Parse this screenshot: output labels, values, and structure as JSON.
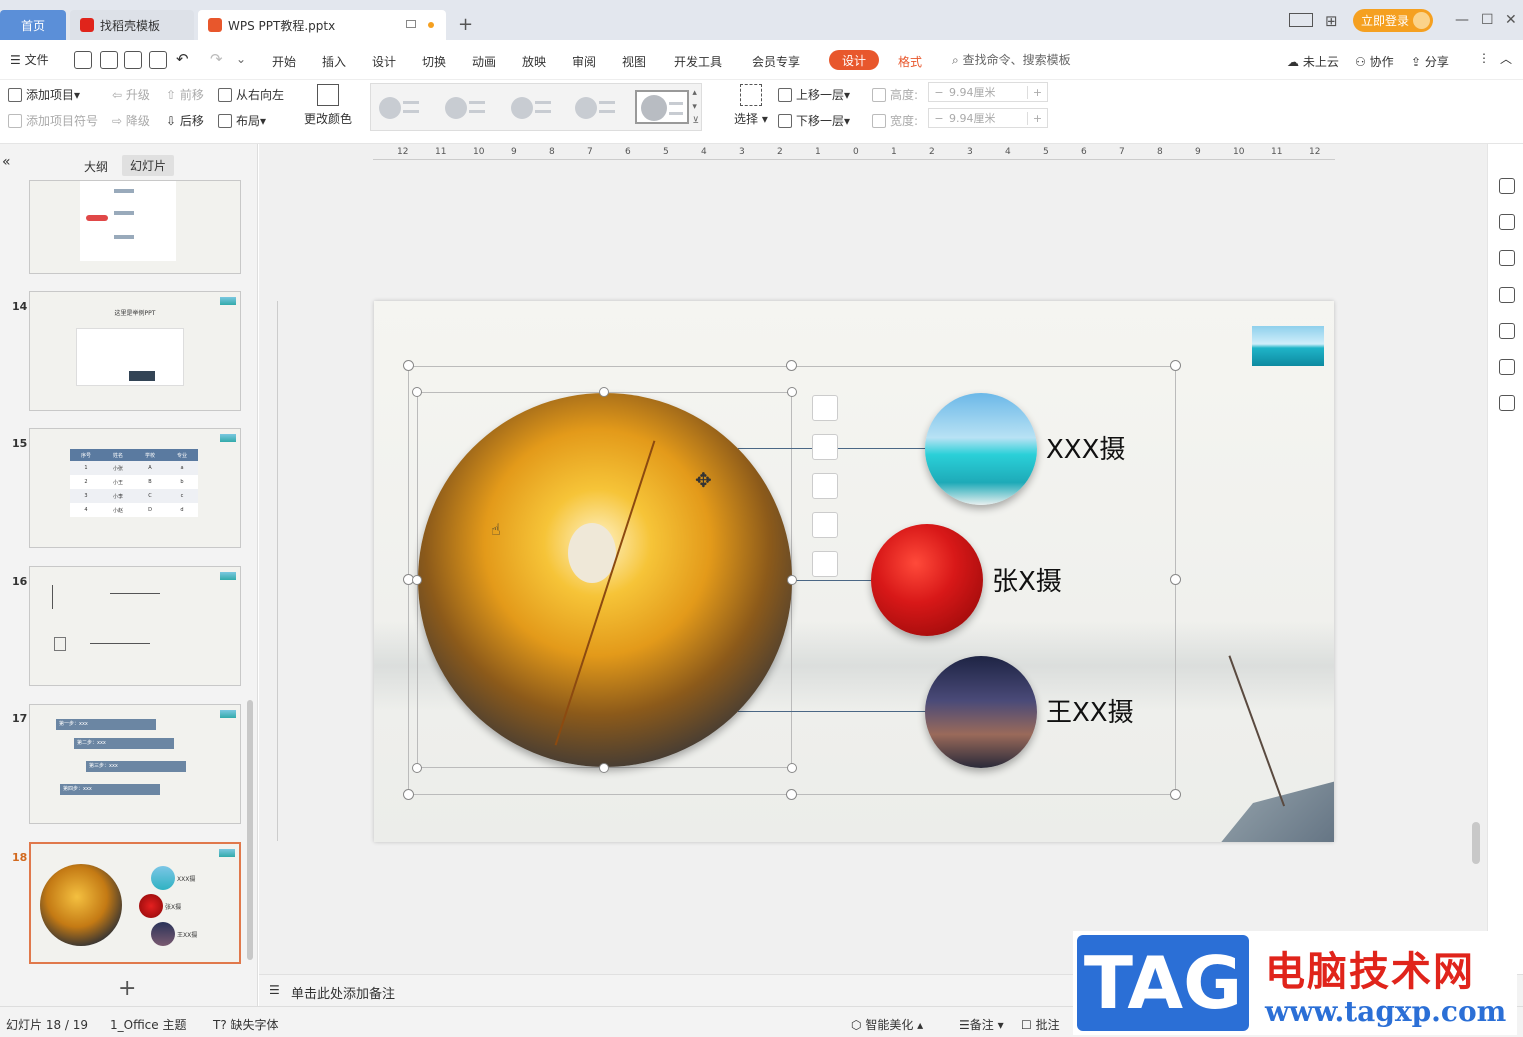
{
  "tabs": {
    "home": "首页",
    "templates": "找稻壳模板",
    "file": "WPS PPT教程.pptx"
  },
  "title_right": {
    "login": "立即登录"
  },
  "menu": {
    "file": "文件",
    "items": [
      "开始",
      "插入",
      "设计",
      "切换",
      "动画",
      "放映",
      "审阅",
      "视图",
      "开发工具",
      "会员专享"
    ],
    "active": "设计",
    "format": "格式",
    "search": "查找命令、搜索模板",
    "cloud": "未上云",
    "collab": "协作",
    "share": "分享"
  },
  "ribbon": {
    "add_item": "添加项目",
    "add_bullet": "添加项目符号",
    "promote": "升级",
    "demote": "降级",
    "move_up": "前移",
    "move_down": "后移",
    "rtl": "从右向左",
    "layout": "布局",
    "change_color": "更改颜色",
    "select": "选择",
    "bring_forward": "上移一层",
    "send_backward": "下移一层",
    "height_label": "高度:",
    "width_label": "宽度:",
    "height_value": "9.94厘米",
    "width_value": "9.94厘米"
  },
  "pane": {
    "outline": "大纲",
    "slides": "幻灯片"
  },
  "thumbnails": [
    {
      "num": "14",
      "title": "这里是举例PPT"
    },
    {
      "num": "15"
    },
    {
      "num": "16"
    },
    {
      "num": "17",
      "steps": [
        "第一步：xxx",
        "第二步：xxx",
        "第三步：xxx",
        "第四步：xxx"
      ]
    },
    {
      "num": "18",
      "captions": [
        "XXX摄",
        "张X摄",
        "王XX摄"
      ]
    }
  ],
  "table15": {
    "headers": [
      "序号",
      "姓名",
      "学校",
      "专业"
    ],
    "rows": [
      [
        "1",
        "小张",
        "A",
        "a"
      ],
      [
        "2",
        "小王",
        "B",
        "b"
      ],
      [
        "3",
        "小李",
        "C",
        "c"
      ],
      [
        "4",
        "小赵",
        "D",
        "d"
      ]
    ]
  },
  "slide": {
    "captions": [
      "XXX摄",
      "张X摄",
      "王XX摄"
    ]
  },
  "ruler_h": [
    "12",
    "11",
    "10",
    "9",
    "8",
    "7",
    "6",
    "5",
    "4",
    "3",
    "2",
    "1",
    "0",
    "1",
    "2",
    "3",
    "4",
    "5",
    "6",
    "7",
    "8",
    "9",
    "10",
    "11",
    "12"
  ],
  "notes": "单击此处添加备注",
  "status": {
    "slide_counter": "幻灯片 18 / 19",
    "theme": "1_Office 主题",
    "missing_font": "缺失字体",
    "beautify": "智能美化",
    "notes": "备注",
    "comments": "批注"
  },
  "watermark": {
    "tag": "TAG",
    "cn": "电脑技术网",
    "url": "www.tagxp.com"
  }
}
